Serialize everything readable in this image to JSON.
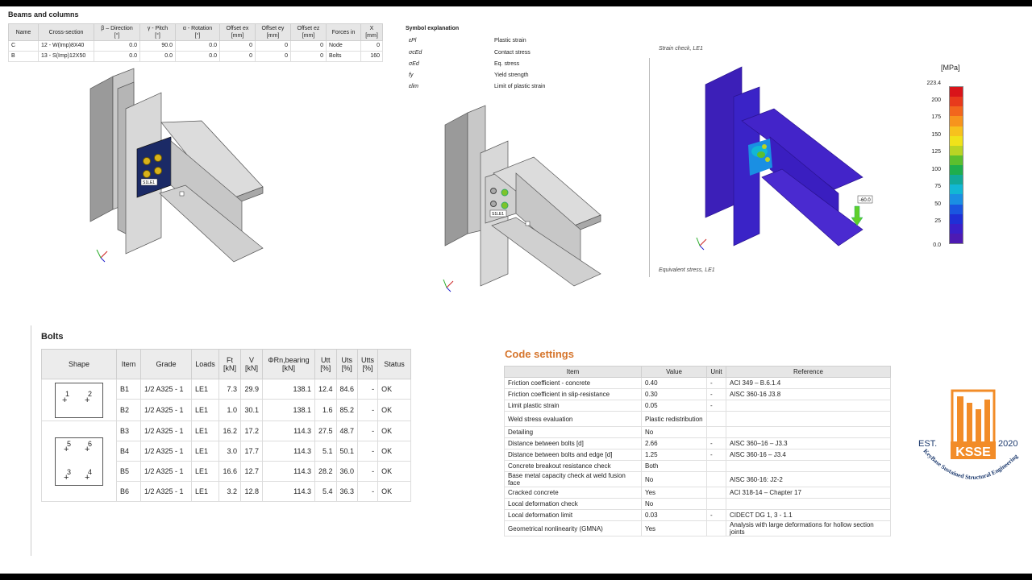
{
  "beams_columns": {
    "title": "Beams and columns",
    "headers": [
      {
        "l1": "Name",
        "l2": ""
      },
      {
        "l1": "Cross-section",
        "l2": ""
      },
      {
        "l1": "β – Direction",
        "l2": "[°]"
      },
      {
        "l1": "γ - Pitch",
        "l2": "[°]"
      },
      {
        "l1": "α - Rotation",
        "l2": "[°]"
      },
      {
        "l1": "Offset ex",
        "l2": "[mm]"
      },
      {
        "l1": "Offset ey",
        "l2": "[mm]"
      },
      {
        "l1": "Offset ez",
        "l2": "[mm]"
      },
      {
        "l1": "Forces in",
        "l2": ""
      },
      {
        "l1": "X",
        "l2": "[mm]"
      }
    ],
    "rows": [
      [
        "C",
        "12 - W(Imp)8X40",
        "0.0",
        "90.0",
        "0.0",
        "0",
        "0",
        "0",
        "Node",
        "0"
      ],
      [
        "B",
        "13 - S(Imp)12X50",
        "0.0",
        "0.0",
        "0.0",
        "0",
        "0",
        "0",
        "Bolts",
        "160"
      ]
    ]
  },
  "symbols": {
    "title": "Symbol explanation",
    "items": [
      {
        "sym": "εPl",
        "desc": "Plastic strain"
      },
      {
        "sym": "σcEd",
        "desc": "Contact stress"
      },
      {
        "sym": "σEd",
        "desc": "Eq. stress"
      },
      {
        "sym": "fy",
        "desc": "Yield strength"
      },
      {
        "sym": "εlim",
        "desc": "Limit of plastic strain"
      }
    ]
  },
  "model_labels": {
    "bolt_tag": "S1LE1"
  },
  "stress_view": {
    "top_caption": "Strain check, LE1",
    "bottom_caption": "Equivalent stress, LE1",
    "load_value": "-60.0",
    "unit": "[MPa]",
    "scale_labels": [
      "223.4",
      "200",
      "175",
      "150",
      "125",
      "100",
      "75",
      "50",
      "25",
      "0.0"
    ],
    "scale_colors": [
      "#d9141a",
      "#e83a1c",
      "#f2661d",
      "#f7941d",
      "#f7c11d",
      "#f0e21a",
      "#b9d424",
      "#5cbf2e",
      "#1fae4d",
      "#12a999",
      "#12b7d4",
      "#1a8fe3",
      "#1a56e0",
      "#1f2fd6",
      "#3a1fc9",
      "#4d1ab3"
    ]
  },
  "bolts": {
    "title": "Bolts",
    "headers": {
      "shape": "Shape",
      "item": "Item",
      "grade": "Grade",
      "loads": "Loads",
      "ft": "Ft",
      "ft_unit": "[kN]",
      "v": "V",
      "v_unit": "[kN]",
      "phir": "ΦRn,bearing",
      "phir_unit": "[kN]",
      "utt": "Utt",
      "utt_unit": "[%]",
      "uts": "Uts",
      "uts_unit": "[%]",
      "utts": "Utts",
      "utts_unit": "[%]",
      "status": "Status"
    },
    "shape1_labels": [
      "1",
      "2"
    ],
    "shape2_labels": [
      "5",
      "6",
      "3",
      "4"
    ],
    "rows": [
      {
        "item": "B1",
        "grade": "1/2 A325 - 1",
        "loads": "LE1",
        "ft": "7.3",
        "v": "29.9",
        "phir": "138.1",
        "utt": "12.4",
        "uts": "84.6",
        "utts": "-",
        "status": "OK"
      },
      {
        "item": "B2",
        "grade": "1/2 A325 - 1",
        "loads": "LE1",
        "ft": "1.0",
        "v": "30.1",
        "phir": "138.1",
        "utt": "1.6",
        "uts": "85.2",
        "utts": "-",
        "status": "OK"
      },
      {
        "item": "B3",
        "grade": "1/2 A325 - 1",
        "loads": "LE1",
        "ft": "16.2",
        "v": "17.2",
        "phir": "114.3",
        "utt": "27.5",
        "uts": "48.7",
        "utts": "-",
        "status": "OK"
      },
      {
        "item": "B4",
        "grade": "1/2 A325 - 1",
        "loads": "LE1",
        "ft": "3.0",
        "v": "17.7",
        "phir": "114.3",
        "utt": "5.1",
        "uts": "50.1",
        "utts": "-",
        "status": "OK"
      },
      {
        "item": "B5",
        "grade": "1/2 A325 - 1",
        "loads": "LE1",
        "ft": "16.6",
        "v": "12.7",
        "phir": "114.3",
        "utt": "28.2",
        "uts": "36.0",
        "utts": "-",
        "status": "OK"
      },
      {
        "item": "B6",
        "grade": "1/2 A325 - 1",
        "loads": "LE1",
        "ft": "3.2",
        "v": "12.8",
        "phir": "114.3",
        "utt": "5.4",
        "uts": "36.3",
        "utts": "-",
        "status": "OK"
      }
    ]
  },
  "code_settings": {
    "title": "Code settings",
    "headers": [
      "Item",
      "Value",
      "Unit",
      "Reference"
    ],
    "rows": [
      [
        "Friction coefficient - concrete",
        "0.40",
        "-",
        "ACI 349 – B.6.1.4"
      ],
      [
        "Friction coefficient in slip-resistance",
        "0.30",
        "-",
        "AISC 360-16 J3.8"
      ],
      [
        "Limit plastic strain",
        "0.05",
        "-",
        ""
      ],
      [
        "Weld stress evaluation",
        "Plastic redistribution",
        "",
        ""
      ],
      [
        "Detailing",
        "No",
        "",
        ""
      ],
      [
        "Distance between bolts [d]",
        "2.66",
        "-",
        "AISC 360–16 – J3.3"
      ],
      [
        "Distance between bolts and edge [d]",
        "1.25",
        "-",
        "AISC 360-16 – J3.4"
      ],
      [
        "Concrete breakout resistance check",
        "Both",
        "",
        ""
      ],
      [
        "Base metal capacity check at weld fusion face",
        "No",
        "",
        "AISC 360-16: J2-2"
      ],
      [
        "Cracked concrete",
        "Yes",
        "",
        "ACI 318-14 – Chapter 17"
      ],
      [
        "Local deformation check",
        "No",
        "",
        ""
      ],
      [
        "Local deformation limit",
        "0.03",
        "-",
        "CIDECT DG 1, 3 - 1.1"
      ],
      [
        "Geometrical nonlinearity (GMNA)",
        "Yes",
        "",
        "Analysis with large deformations for hollow section joints"
      ]
    ]
  },
  "logo": {
    "est": "EST.",
    "year": "2020",
    "abbr": "KSSE",
    "name": "KeyBase Sustained Structural Engineering"
  }
}
